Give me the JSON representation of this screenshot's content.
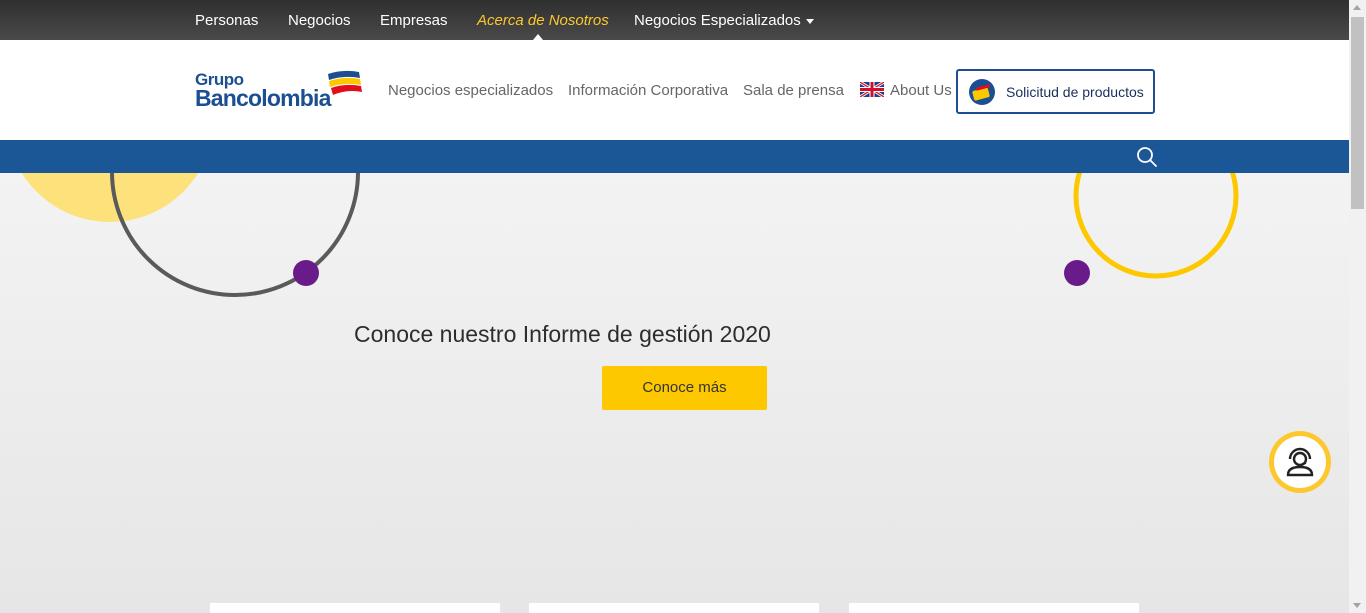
{
  "topnav": {
    "items": [
      {
        "label": "Personas"
      },
      {
        "label": "Negocios"
      },
      {
        "label": "Empresas"
      },
      {
        "label": "Acerca de Nosotros",
        "active": true
      },
      {
        "label": "Negocios Especializados",
        "dropdown": true
      }
    ]
  },
  "header": {
    "logo_line1": "Grupo",
    "logo_line2": "Bancolombia",
    "nav": [
      {
        "label": "Negocios especializados"
      },
      {
        "label": "Información Corporativa"
      },
      {
        "label": "Sala de prensa"
      },
      {
        "label": "About Us",
        "icon": "uk-flag-icon"
      }
    ],
    "cta_label": "Solicitud de productos"
  },
  "search": {
    "icon": "search-icon"
  },
  "hero": {
    "headline": "Conoce nuestro Informe de gestión 2020",
    "button_label": "Conoce más"
  },
  "chat": {
    "icon": "agent-headset-icon"
  },
  "colors": {
    "brand_blue": "#1b5697",
    "accent_yellow": "#fdc800",
    "topbar": "#3c3c3c",
    "decor_purple": "#6a1b8a"
  }
}
